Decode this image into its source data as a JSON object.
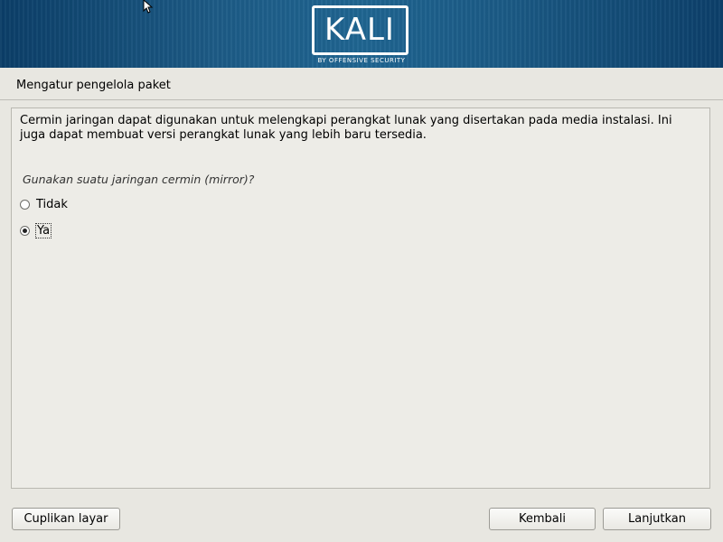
{
  "header": {
    "logo_text": "KALI",
    "logo_sub": "BY OFFENSIVE SECURITY"
  },
  "page": {
    "title": "Mengatur pengelola paket"
  },
  "content": {
    "description": "Cermin jaringan dapat digunakan untuk melengkapi perangkat lunak yang disertakan pada media instalasi. Ini juga dapat membuat versi perangkat lunak yang lebih baru tersedia.",
    "question": "Gunakan suatu jaringan cermin (mirror)?",
    "options": [
      {
        "label": "Tidak",
        "selected": false
      },
      {
        "label": "Ya",
        "selected": true
      }
    ]
  },
  "buttons": {
    "screenshot": "Cuplikan layar",
    "back": "Kembali",
    "continue": "Lanjutkan"
  },
  "colors": {
    "header_blue": "#1d5b86",
    "background": "#e8e7e1"
  },
  "icons": {
    "cursor": "mouse-pointer-icon"
  }
}
